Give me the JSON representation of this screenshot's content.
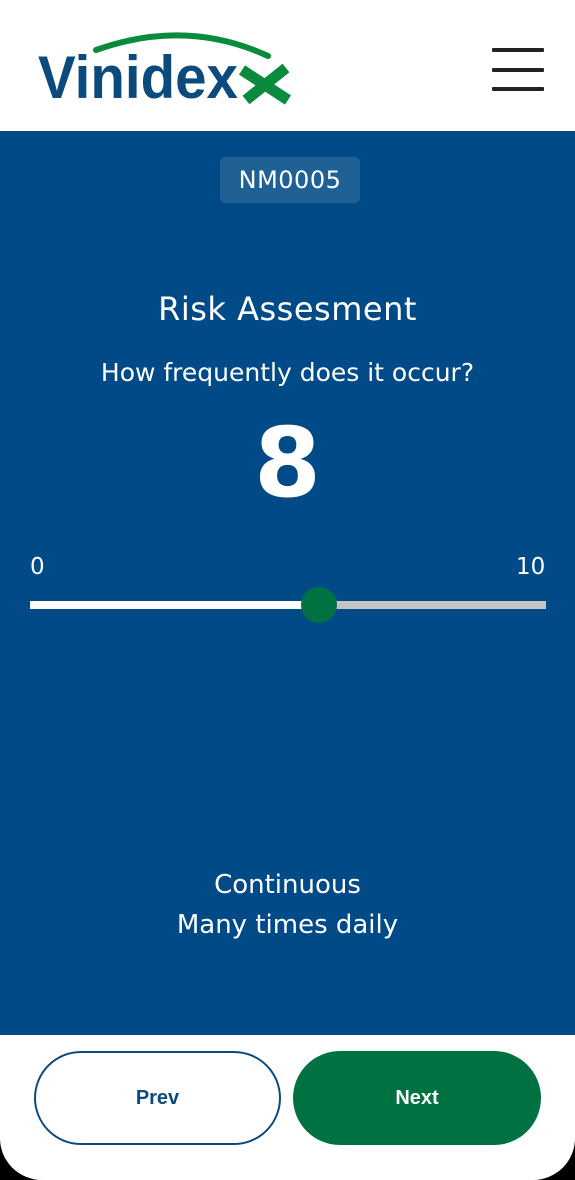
{
  "header": {
    "logo_text": "Vinidex",
    "menu_icon": "hamburger-menu-icon"
  },
  "assessment": {
    "code": "NM0005",
    "title": "Risk Assesment",
    "question": "How frequently does it occur?",
    "value": "8"
  },
  "slider": {
    "min_label": "0",
    "max_label": "10",
    "level_fraction": 0.56
  },
  "description": {
    "line1": "Continuous",
    "line2": "Many times daily"
  },
  "buttons": {
    "prev_label": "Prev",
    "next_label": "Next"
  },
  "colors": {
    "background": "#004a87",
    "accent_green": "#007140",
    "logo_blue": "#0b4a7d",
    "track_grey": "#c4c4c4"
  }
}
